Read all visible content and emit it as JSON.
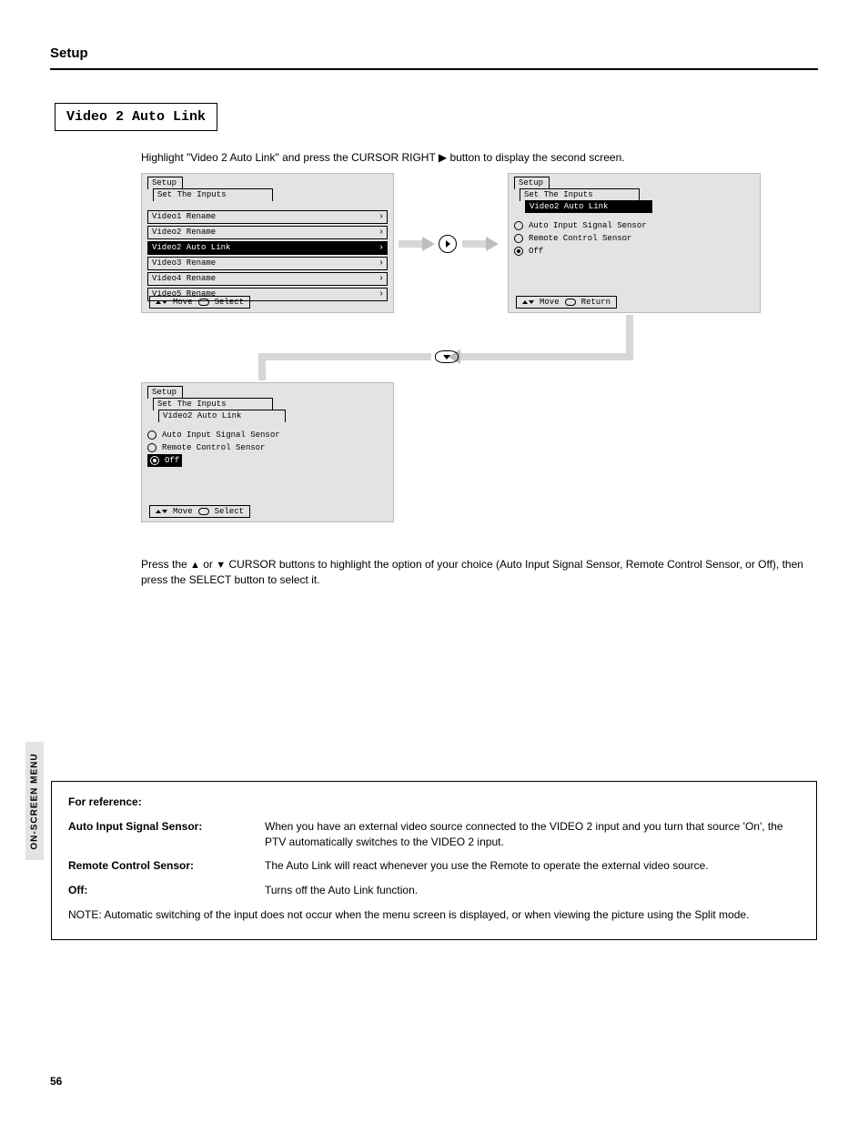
{
  "page": {
    "number": "56",
    "header": "Setup",
    "section_title": "Video 2 Auto Link"
  },
  "intro": "Highlight \"Video 2 Auto Link\" and press the CURSOR RIGHT ▶ button to display the second screen.",
  "osd": {
    "tabs": [
      "Setup",
      "Set The Inputs"
    ],
    "panel1": {
      "selected_tab_index": 1,
      "items": [
        {
          "label": "Video1 Rename",
          "selected": false
        },
        {
          "label": "Video2 Rename",
          "selected": false
        },
        {
          "label": "Video2 Auto Link",
          "selected": true
        },
        {
          "label": "Video3 Rename",
          "selected": false
        },
        {
          "label": "Video4 Rename",
          "selected": false
        },
        {
          "label": "Video5 Rename",
          "selected": false
        }
      ],
      "footer": {
        "left": "Move",
        "right": "Select"
      }
    },
    "panel2": {
      "crumb3": "Video2 Auto Link",
      "options": [
        {
          "label": "Auto Input Signal Sensor",
          "checked": false,
          "highlight": false
        },
        {
          "label": "Remote Control Sensor",
          "checked": false,
          "highlight": false
        },
        {
          "label": "Off",
          "checked": true,
          "highlight": false
        }
      ],
      "footer": {
        "left": "Move",
        "right": "Return"
      }
    },
    "panel3": {
      "crumb3": "Video2 Auto Link",
      "options": [
        {
          "label": "Auto Input Signal Sensor",
          "checked": false,
          "highlight": false
        },
        {
          "label": "Remote Control Sensor",
          "checked": false,
          "highlight": false
        },
        {
          "label": "Off",
          "checked": true,
          "highlight": true
        }
      ],
      "footer": {
        "left": "Move",
        "right": "Select"
      }
    }
  },
  "instructions": "Press the ▲ or ▼ CURSOR buttons to highlight the option of your choice (Auto Input Signal Sensor, Remote Control Sensor, or Off), then press the SELECT button to select it.",
  "ref": {
    "side_label": "ON-SCREEN MENU",
    "title": "For reference:",
    "rows": [
      {
        "term": "Auto Input Signal Sensor:",
        "desc": "When you have an external video source connected to the VIDEO 2 input and you turn that source 'On', the PTV automatically switches to the VIDEO 2 input."
      },
      {
        "term": "Remote Control Sensor:",
        "desc": "The Auto Link will react whenever you use the Remote to operate the external video source."
      },
      {
        "term": "Off:",
        "desc": "Turns off the Auto Link function."
      }
    ],
    "note": "NOTE: Automatic switching of the input does not occur when the menu screen is displayed, or when viewing the picture using the Split mode."
  }
}
